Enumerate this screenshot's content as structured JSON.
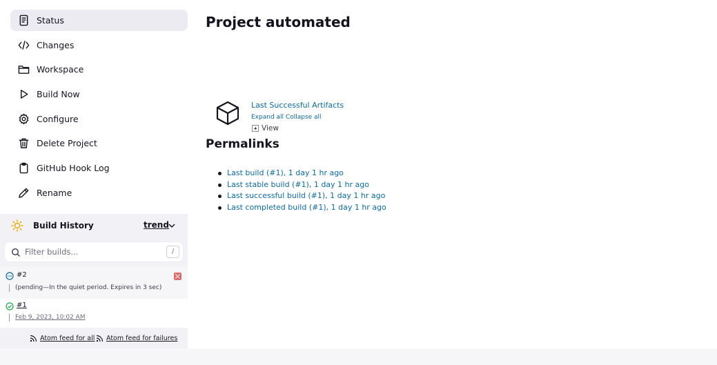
{
  "sidebar": {
    "tasks": [
      {
        "label": "Status",
        "icon": "document-icon",
        "active": true
      },
      {
        "label": "Changes",
        "icon": "code-icon"
      },
      {
        "label": "Workspace",
        "icon": "folder-icon"
      },
      {
        "label": "Build Now",
        "icon": "play-icon"
      },
      {
        "label": "Configure",
        "icon": "gear-icon"
      },
      {
        "label": "Delete Project",
        "icon": "trash-icon"
      },
      {
        "label": "GitHub Hook Log",
        "icon": "clipboard-icon"
      },
      {
        "label": "Rename",
        "icon": "pencil-icon"
      }
    ]
  },
  "build_history": {
    "title": "Build History",
    "trend_label": "trend",
    "filter_placeholder": "Filter builds...",
    "shortcut_key": "/",
    "builds": [
      {
        "number": "#2",
        "status": "pending",
        "description": "(pending—In the quiet period. Expires in 3 sec)"
      },
      {
        "number": "#1",
        "status": "success",
        "description": "Feb 9, 2023, 10:02 AM"
      }
    ],
    "feeds": {
      "all": "Atom feed for all",
      "failures": "Atom feed for failures"
    }
  },
  "main": {
    "title": "Project automated",
    "artifacts_link": "Last Successful Artifacts",
    "expand_all": "Expand all",
    "collapse_all": "Collapse all",
    "view_label": "View",
    "permalinks_title": "Permalinks",
    "permalinks": [
      "Last build (#1), 1 day 1 hr ago",
      "Last stable build (#1), 1 day 1 hr ago",
      "Last successful build (#1), 1 day 1 hr ago",
      "Last completed build (#1), 1 day 1 hr ago"
    ]
  },
  "colors": {
    "link": "#0b6aa2",
    "success": "#1ea64b",
    "pending": "#0b6aa2",
    "sun": "#f2a900",
    "cancel": "#e06a6a"
  }
}
